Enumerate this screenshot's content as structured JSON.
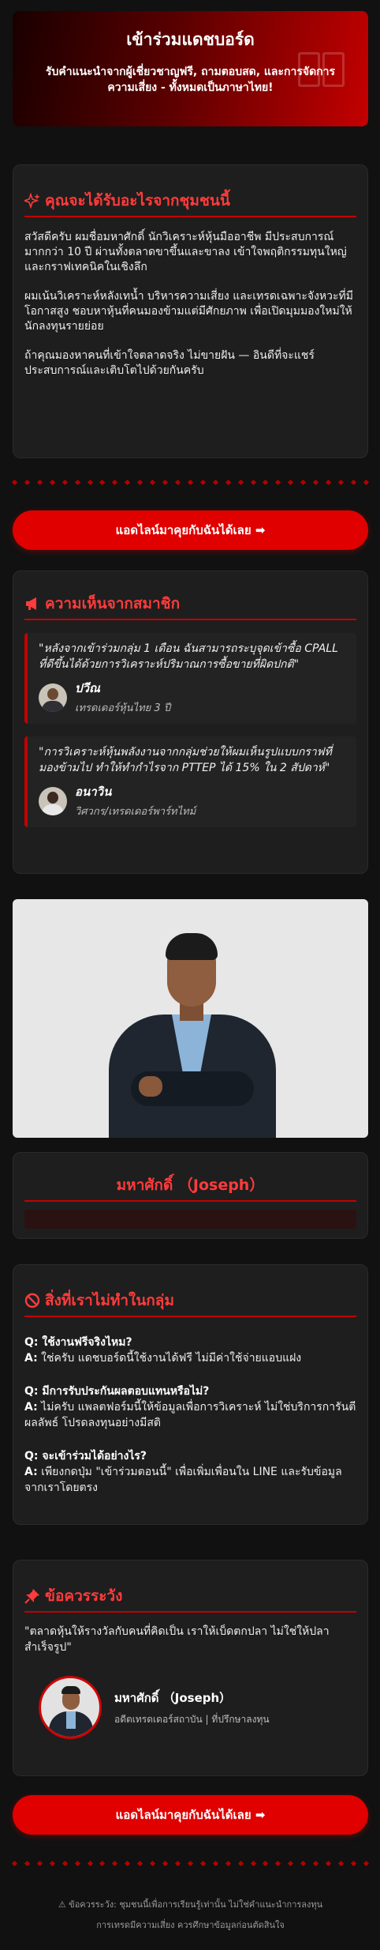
{
  "header": {
    "title": "เข้าร่วมแดชบอร์ด",
    "subtitle": "รับคำแนะนำจากผู้เชี่ยวชาญฟรี, ถามตอบสด, และการจัดการความเสี่ยง - ทั้งหมดเป็นภาษาไทย!"
  },
  "benefits": {
    "title": "คุณจะได้รับอะไรจากชุมชนนี้",
    "paragraphs": [
      "สวัสดีครับ ผมชื่อมหาศักดิ์ นักวิเคราะห์หุ้นมืออาชีพ มีประสบการณ์มากกว่า 10 ปี ผ่านทั้งตลาดขาขึ้นและขาลง เข้าใจพฤติกรรมทุนใหญ่และกราฟเทคนิคในเชิงลึก",
      "ผมเน้นวิเคราะห์หลังเทน้ำ บริหารความเสี่ยง และเทรดเฉพาะจังหวะที่มีโอกาสสูง ชอบหาหุ้นที่คนมองข้ามแต่มีศักยภาพ เพื่อเปิดมุมมองใหม่ให้นักลงทุนรายย่อย",
      "ถ้าคุณมองหาคนที่เข้าใจตลาดจริง ไม่ขายฝัน — อินดีที่จะแชร์ประสบการณ์และเติบโตไปด้วยกันครับ"
    ]
  },
  "cta": {
    "label": "แอดไลน์มาคุยกับฉันได้เลย ➡"
  },
  "testimonials": {
    "title": "ความเห็นจากสมาชิก",
    "items": [
      {
        "quote": "\"หลังจากเข้าร่วมกลุ่ม 1 เดือน ฉันสามารถระบุจุดเข้าซื้อ CPALL ที่ดีขึ้นได้ด้วยการวิเคราะห์ปริมาณการซื้อขายที่ผิดปกติ\"",
        "name": "ปวีณ",
        "role": "เทรดเดอร์หุ้นไทย 3 ปี"
      },
      {
        "quote": "\"การวิเคราะห์หุ้นพลังงานจากกลุ่มช่วยให้ผมเห็นรูปแบบกราฟที่มองข้ามไป ทำให้ทำกำไรจาก PTTEP ได้ 15% ใน 2 สัปดาห์\"",
        "name": "อนาวิน",
        "role": "วิศวกร/เทรดเดอร์พาร์ทไทม์"
      }
    ]
  },
  "profile": {
    "name": "มหาศักดิ์ （Joseph）"
  },
  "nodo": {
    "title": "สิ่งที่เราไม่ทำในกลุ่ม",
    "items": [
      {
        "q": "Q: ใช้งานฟรีจริงไหม?",
        "a_label": "A:",
        "a": "ใช่ครับ แดชบอร์ดนี้ใช้งานได้ฟรี ไม่มีค่าใช้จ่ายแอบแฝง"
      },
      {
        "q": "Q: มีการรับประกันผลตอบแทนหรือไม่?",
        "a_label": "A:",
        "a": "ไม่ครับ แพลตฟอร์มนี้ให้ข้อมูลเพื่อการวิเคราะห์ ไม่ใช่บริการการันตีผลลัพธ์ โปรดลงทุนอย่างมีสติ"
      },
      {
        "q": "Q: จะเข้าร่วมได้อย่างไร?",
        "a_label": "A:",
        "a": "เพียงกดปุ่ม \"เข้าร่วมตอนนี้\" เพื่อเพิ่มเพื่อนใน LINE และรับข้อมูลจากเราโดยตรง"
      }
    ]
  },
  "warning": {
    "title": "ข้อควรระวัง",
    "quote": "\"ตลาดหุ้นให้รางวัลกับคนที่คิดเป็น เราให้เบ็ดตกปลา ไม่ใช่ให้ปลาสำเร็จรูป\"",
    "name": "มหาศักดิ์ （Joseph）",
    "role": "อดีตเทรดเดอร์สถาบัน | ที่ปรึกษาลงทุน"
  },
  "footer": {
    "text": "⚠ ข้อควรระวัง: ชุมชนนี้เพื่อการเรียนรู้เท่านั้น ไม่ใช่คำแนะนำการลงทุน การเทรดมีความเสี่ยง ควรศึกษาข้อมูลก่อนตัดสินใจ"
  }
}
